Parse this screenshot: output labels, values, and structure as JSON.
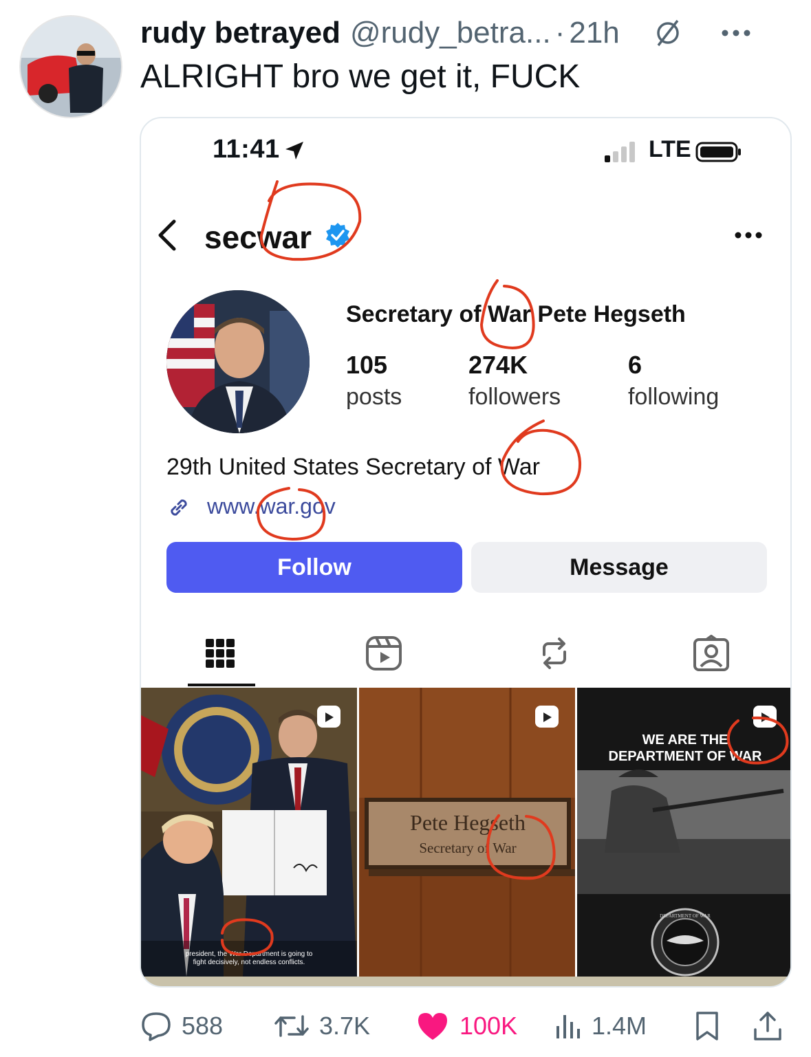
{
  "tweet": {
    "display_name": "rudy betrayed",
    "handle": "@rudy_betra...",
    "separator": "·",
    "time": "21h",
    "text": "ALRIGHT bro we get it, FUCK",
    "icons": [
      "grok-icon",
      "more-icon"
    ]
  },
  "screenshot": {
    "status_bar": {
      "time": "11:41",
      "network": "LTE"
    },
    "profile": {
      "username": "secwar",
      "name": "Secretary of War Pete Hegseth",
      "stats": [
        {
          "value": "105",
          "label": "posts"
        },
        {
          "value": "274K",
          "label": "followers"
        },
        {
          "value": "6",
          "label": "following"
        }
      ],
      "bio": "29th United States Secretary of War",
      "link": "www.war.gov",
      "follow_label": "Follow",
      "message_label": "Message"
    },
    "tabs": [
      "grid-icon",
      "reels-icon",
      "reposts-icon",
      "tagged-icon"
    ],
    "posts": [
      {
        "caption_line1": "president, the War Department is going to",
        "caption_line2": "fight decisively, not endless conflicts."
      },
      {
        "plaque_name": "Pete Hegseth",
        "plaque_title": "Secretary of War"
      },
      {
        "line1": "WE ARE THE",
        "line2": "DEPARTMENT OF WAR",
        "seal_text": "DEPARTMENT OF WAR"
      }
    ],
    "annotation_color": "#e03a1e"
  },
  "actions": {
    "replies": "588",
    "retweets": "3.7K",
    "likes": "100K",
    "views": "1.4M",
    "like_color": "#f91880"
  }
}
